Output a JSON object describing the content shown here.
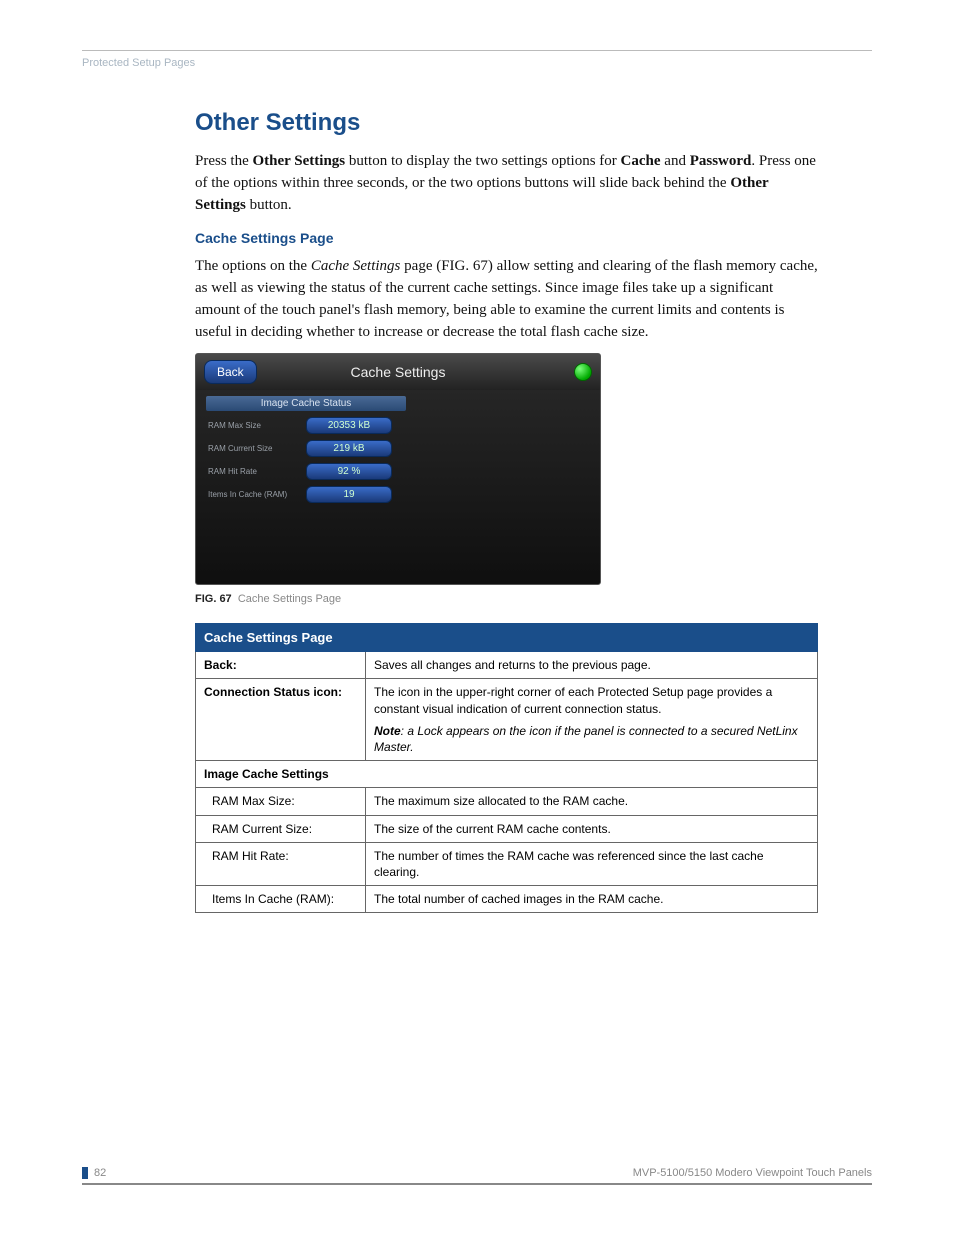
{
  "header": {
    "section": "Protected Setup Pages"
  },
  "h1": "Other Settings",
  "p1": {
    "t1": "Press the ",
    "b1": "Other Settings",
    "t2": " button to display the two settings options for ",
    "b2": "Cache",
    "t3": " and ",
    "b3": "Password",
    "t4": ". Press one of the options within three seconds, or the two options buttons will slide back behind the ",
    "b4": "Other Settings",
    "t5": " button."
  },
  "h2": "Cache Settings Page",
  "p2": {
    "t1": "The options on the ",
    "i1": "Cache Settings",
    "t2": " page (FIG. 67) allow setting and clearing of the flash memory cache, as well as viewing the status of the current cache settings. Since image files take up a significant amount of the touch panel's flash memory, being able to examine the current limits and contents is useful in deciding whether to increase or decrease the total flash cache size."
  },
  "figure": {
    "back": "Back",
    "title": "Cache Settings",
    "section": "Image Cache Status",
    "rows": [
      {
        "label": "RAM Max Size",
        "value": "20353 kB"
      },
      {
        "label": "RAM Current Size",
        "value": "219 kB"
      },
      {
        "label": "RAM Hit Rate",
        "value": "92 %"
      },
      {
        "label": "Items In Cache (RAM)",
        "value": "19"
      }
    ],
    "caption_num": "FIG. 67",
    "caption_text": "Cache Settings Page"
  },
  "table": {
    "title": "Cache Settings Page",
    "rows": [
      {
        "c1": "Back:",
        "c2": "Saves all changes and returns to the previous page.",
        "bold": true
      },
      {
        "c1": "Connection Status icon:",
        "c2a": "The icon in the upper-right corner of each Protected Setup page provides a constant visual indication of current connection status.",
        "note_b": "Note",
        "note_i": ": a Lock appears on the icon if the panel is connected to a secured NetLinx Master.",
        "bold": true
      },
      {
        "section": "Image Cache Settings"
      },
      {
        "c1": "RAM Max Size:",
        "c2": "The maximum size allocated to the RAM cache.",
        "sub": true
      },
      {
        "c1": "RAM Current Size:",
        "c2": "The size of the current RAM cache contents.",
        "sub": true
      },
      {
        "c1": "RAM Hit Rate:",
        "c2": "The number of times the RAM cache was referenced since the last cache clearing.",
        "sub": true
      },
      {
        "c1": "Items In Cache (RAM):",
        "c2": "The total number of cached images in the RAM cache.",
        "sub": true
      }
    ]
  },
  "footer": {
    "page": "82",
    "doc": "MVP-5100/5150 Modero Viewpoint  Touch Panels"
  }
}
